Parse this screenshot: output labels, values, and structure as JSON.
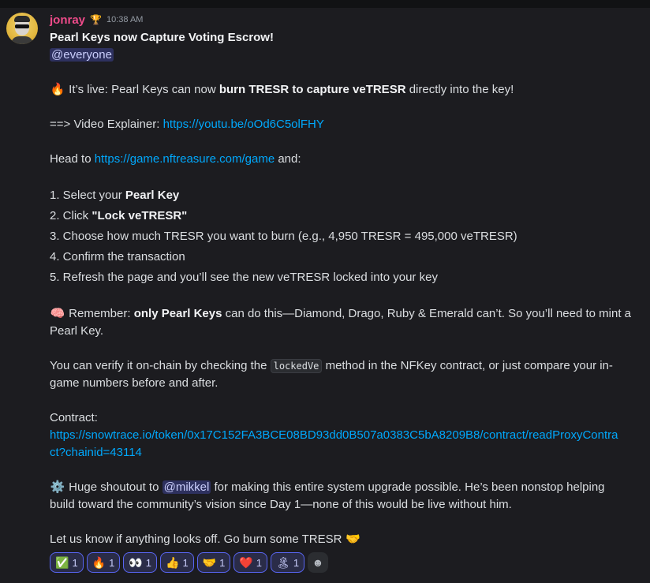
{
  "message": {
    "username": "jonray",
    "badge_icon": "trophy-icon",
    "timestamp": "10:38 AM",
    "title": "Pearl Keys now Capture Voting Escrow!",
    "everyone_mention": "@everyone",
    "line1_prefix": "It’s live: Pearl Keys can now ",
    "line1_bold": "burn TRESR to capture veTRESR",
    "line1_suffix": " directly into the key!",
    "video_prefix": "==> Video Explainer: ",
    "video_link": "https://youtu.be/oOd6C5olFHY",
    "head_prefix": "Head to ",
    "head_link": "https://game.nftreasure.com/game",
    "head_suffix": " and:",
    "step1_prefix": "1. Select your ",
    "step1_bold": "Pearl Key",
    "step2_prefix": "2. Click ",
    "step2_bold": "\"Lock veTRESR\"",
    "step3": "3. Choose how much TRESR you want to burn (e.g., 4,950 TRESR = 495,000 veTRESR)",
    "step4": "4. Confirm the transaction",
    "step5": "5. Refresh the page and you’ll see the new veTRESR locked into your key",
    "remember_prefix": "Remember: ",
    "remember_bold": "only Pearl Keys",
    "remember_suffix_line1": " can do this—Diamond, Drago, Ruby & Emerald can’t. So you’ll need to mint a",
    "remember_line2": "Pearl Key.",
    "verify_prefix": "You can verify it on-chain by checking the ",
    "verify_code": "lockedVe",
    "verify_suffix_line1": " method in the NFKey contract, or just compare your in-",
    "verify_line2": "game numbers before and after.",
    "contract_label": "Contract:",
    "contract_link_line1": "https://snowtrace.io/token/0x17C152FA3BCE08BD93dd0B507a0383C5bA8209B8/contract/readProxyContra",
    "contract_link_line2": "ct?chainid=43114",
    "shoutout_prefix": "Huge shoutout to ",
    "shoutout_mention": "@mikkel",
    "shoutout_suffix_line1": " for making this entire system upgrade possible. He’s been nonstop helping",
    "shoutout_line2": "build toward the community’s vision since Day 1—none of this would be live without him.",
    "closing": "Let us know if anything looks off. Go burn some TRESR "
  },
  "reactions": [
    {
      "icon": "✅",
      "count": "1"
    },
    {
      "icon": "🔥",
      "count": "1"
    },
    {
      "icon": "👀",
      "count": "1"
    },
    {
      "icon": "👍",
      "count": "1"
    },
    {
      "icon": "🤝",
      "count": "1"
    },
    {
      "icon": "❤️",
      "count": "1"
    },
    {
      "icon": "🏝",
      "count": "1"
    }
  ]
}
